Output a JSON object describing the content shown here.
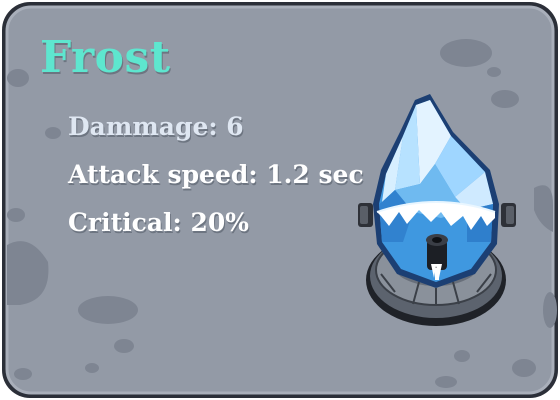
{
  "tower": {
    "name": "Frost",
    "stats": {
      "damage": "Dammage: 6",
      "attack_speed": "Attack speed: 1.2 sec",
      "critical": "Critical: 20%"
    },
    "icon": "frost-crystal-tower-icon"
  },
  "colors": {
    "title": "#5ee6cf",
    "panel": "#939aa6",
    "panel_border": "#2b2f38",
    "stat_text": "#ffffff",
    "crystal": "#4aa4e6"
  }
}
